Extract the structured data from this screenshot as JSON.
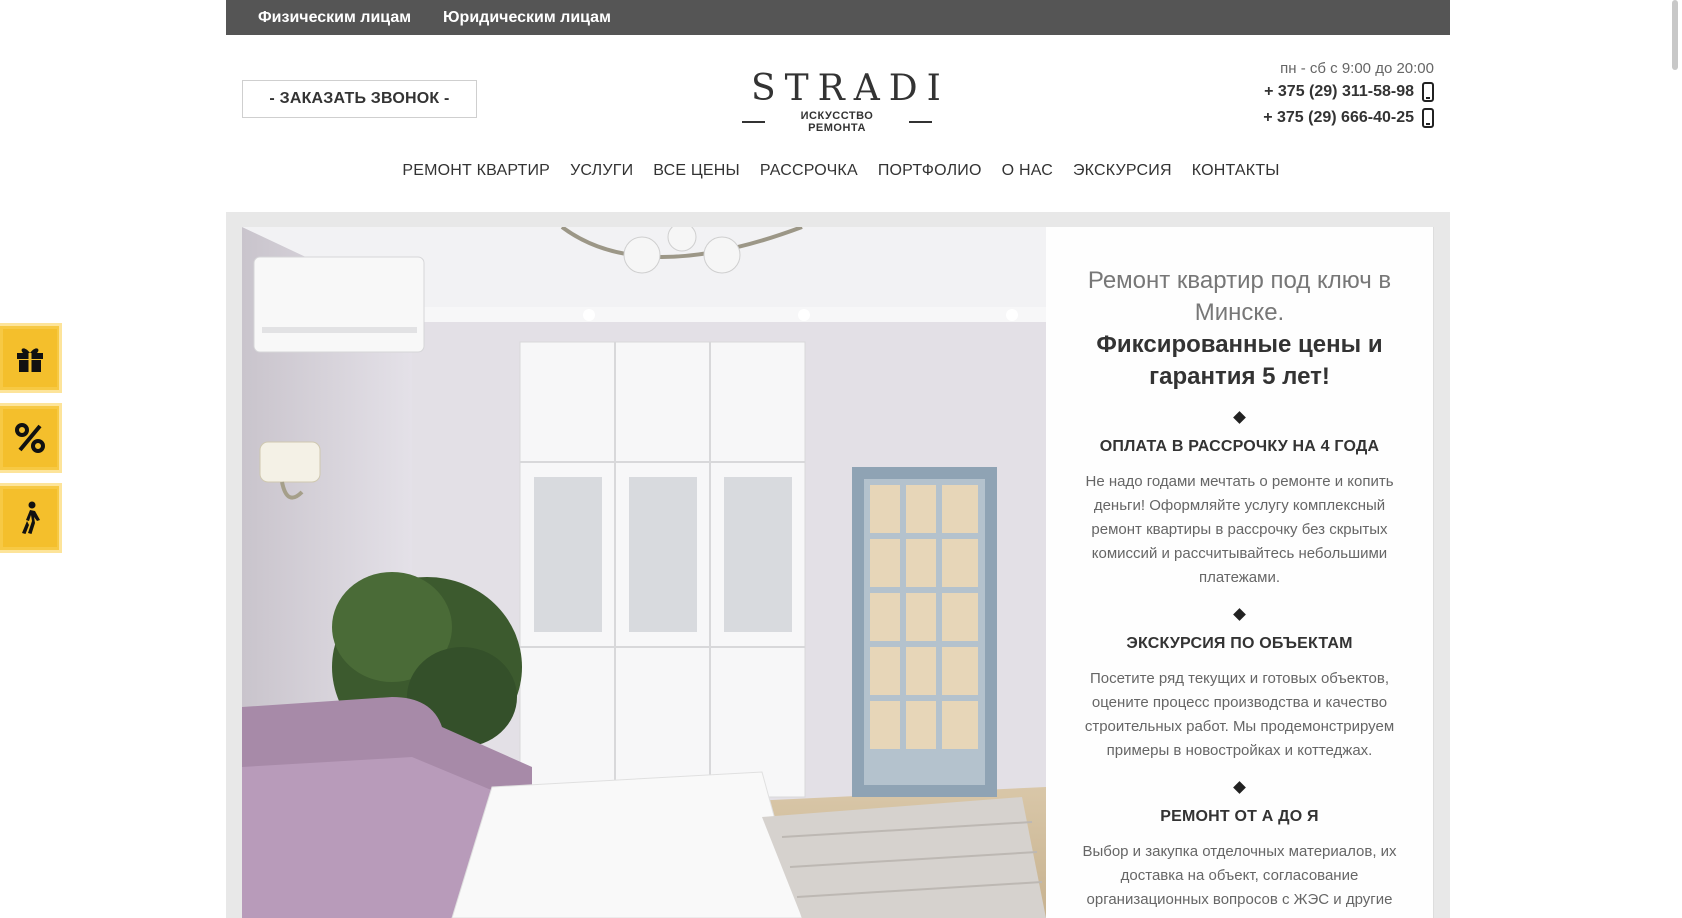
{
  "topbar": {
    "links": [
      "Физическим лицам",
      "Юридическим лицам"
    ]
  },
  "header": {
    "callback_label": "- ЗАКАЗАТЬ ЗВОНОК -",
    "logo": {
      "brand": "STRADI",
      "tagline": "ИСКУССТВО РЕМОНТА"
    },
    "hours": "пн - сб с 9:00 до 20:00",
    "phones": [
      "+ 375 (29) 311-58-98",
      "+ 375 (29) 666-40-25"
    ]
  },
  "nav": {
    "items": [
      "РЕМОНТ КВАРТИР",
      "УСЛУГИ",
      "ВСЕ ЦЕНЫ",
      "РАССРОЧКА",
      "ПОРТФОЛИО",
      "О НАС",
      "ЭКСКУРСИЯ",
      "КОНТАКТЫ"
    ]
  },
  "hero": {
    "heading_light": "Ремонт квартир под ключ в Минске.",
    "heading_bold": "Фиксированные цены и гарантия 5 лет!",
    "features": [
      {
        "title": "ОПЛАТА В РАССРОЧКУ НА 4 ГОДА",
        "text": "Не надо годами мечтать о ремонте и копить деньги! Оформляйте услугу комплексный ремонт квартиры в рассрочку без скрытых комиссий и рассчитывайтесь небольшими платежами."
      },
      {
        "title": "ЭКСКУРСИЯ ПО ОБЪЕКТАМ",
        "text": "Посетите ряд текущих и готовых объектов, оцените процесс производства и качество строительных работ. Мы продемонстрируем примеры в новостройках и коттеджах."
      },
      {
        "title": "РЕМОНТ ОТ А ДО Я",
        "text": "Выбор и закупка отделочных материалов, их доставка на объект, согласование организационных вопросов с ЖЭС и другие"
      }
    ]
  },
  "side_widgets": {
    "icons": [
      "gift-icon",
      "percent-icon",
      "walking-person-icon"
    ]
  },
  "colors": {
    "topbar_bg": "#555555",
    "widget_yellow": "#f4bf2c",
    "hero_frame": "#e8e8e8"
  }
}
